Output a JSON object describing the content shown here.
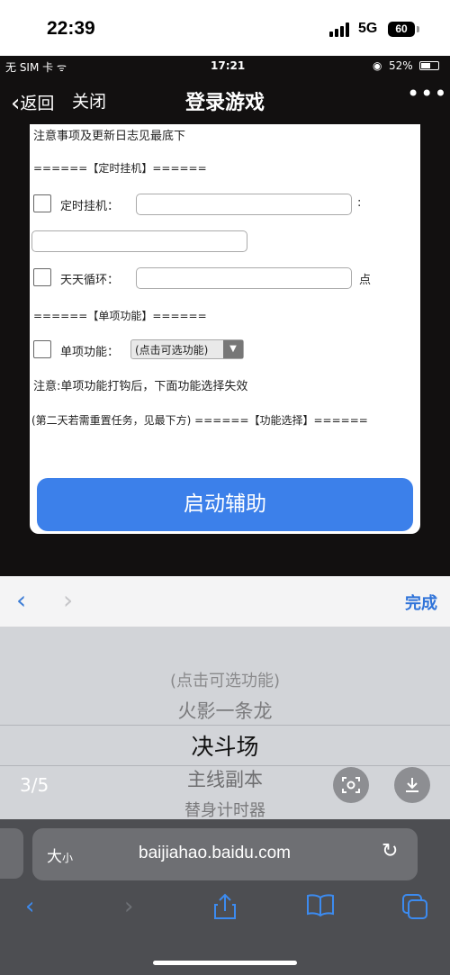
{
  "status": {
    "time": "22:39",
    "network": "5G",
    "battery": "60"
  },
  "embedded": {
    "status": {
      "carrier": "无 SIM 卡 ᯤ",
      "time": "17:21",
      "battery": "52%"
    },
    "nav": {
      "back": "返回",
      "close": "关闭",
      "title": "登录游戏",
      "more": "•••"
    },
    "panel": {
      "notice": "注意事项及更新日志见最底下",
      "section_timer": "======【定时挂机】======",
      "timer_label": "定时挂机：",
      "timer_sep": ":",
      "daily_label": "天天循环：",
      "daily_unit": "点",
      "section_single": "======【单项功能】======",
      "single_label": "单项功能：",
      "single_select": "(点击可选功能)",
      "single_note": "注意:单项功能打钩后，下面功能选择失效",
      "reset_note": "(第二天若需重置任务，见最下方) ======【功能选择】======",
      "start_button": "启动辅助"
    }
  },
  "accessory": {
    "prev": "‹",
    "next": "›",
    "done": "完成"
  },
  "picker": {
    "options": [
      "(点击可选功能)",
      "火影一条龙",
      "决斗场",
      "主线副本",
      "替身计时器"
    ],
    "selected": "决斗场"
  },
  "viewer": {
    "page_counter": "3/5"
  },
  "browser": {
    "size_label": "大",
    "size_small": "小",
    "url": "baijiahao.baidu.com"
  }
}
